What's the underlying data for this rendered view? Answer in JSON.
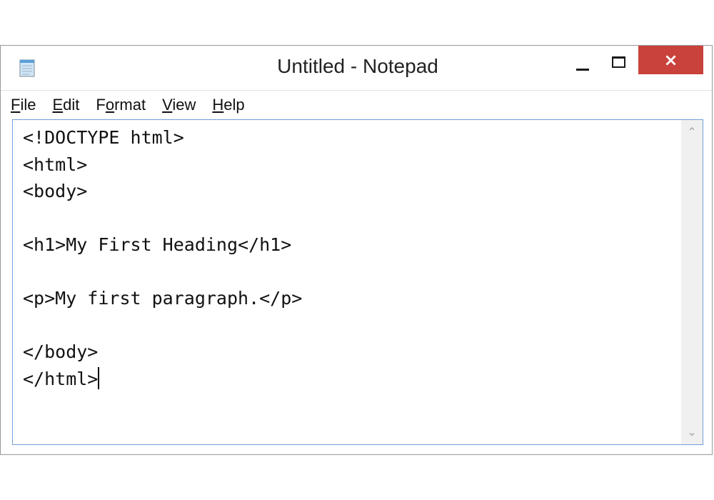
{
  "window": {
    "title": "Untitled - Notepad",
    "close_glyph": "×"
  },
  "icons": {
    "app": "notepad-icon",
    "minimize": "minimize-icon",
    "maximize": "maximize-icon",
    "close": "close-icon",
    "scroll_up": "chevron-up-icon",
    "scroll_down": "chevron-down-icon"
  },
  "menu": {
    "items": [
      {
        "mnemonic": "F",
        "rest": "ile"
      },
      {
        "mnemonic": "E",
        "rest": "dit"
      },
      {
        "pre": "F",
        "mnemonic": "o",
        "rest": "rmat"
      },
      {
        "mnemonic": "V",
        "rest": "iew"
      },
      {
        "mnemonic": "H",
        "rest": "elp"
      }
    ]
  },
  "editor": {
    "text": "<!DOCTYPE html>\n<html>\n<body>\n\n<h1>My First Heading</h1>\n\n<p>My first paragraph.</p>\n\n</body>\n</html>"
  },
  "scrollbar": {
    "up_glyph": "⌃",
    "down_glyph": "⌄"
  },
  "colors": {
    "close_button": "#c9423b",
    "edit_border": "#6f9ed8",
    "text": "#111111"
  }
}
